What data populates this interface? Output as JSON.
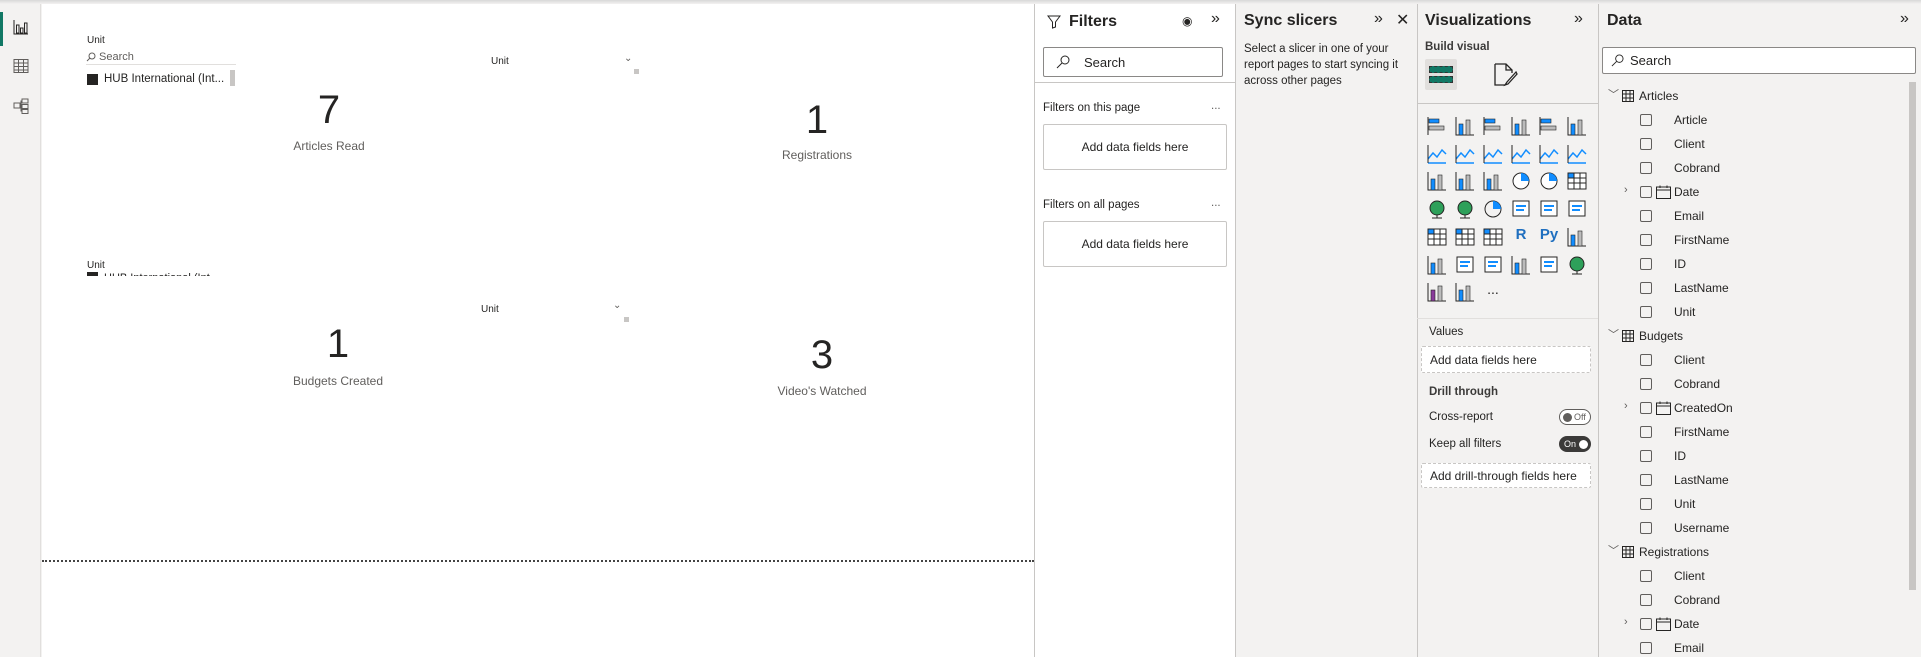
{
  "nav": {
    "items": [
      {
        "name": "report-view",
        "icon": "bar-chart-icon",
        "selected": true
      },
      {
        "name": "table-view",
        "icon": "table-icon"
      },
      {
        "name": "model-view",
        "icon": "model-icon"
      }
    ]
  },
  "canvas": {
    "slicer_list": {
      "title": "Unit",
      "search_placeholder": "Search",
      "item": "HUB International (Int..."
    },
    "slicer_list_2": {
      "title": "Unit",
      "item": "HUB International (Int..."
    },
    "dropdown_1": {
      "title": "Unit"
    },
    "dropdown_2": {
      "title": "Unit"
    },
    "cards": [
      {
        "value": "7",
        "label": "Articles Read"
      },
      {
        "value": "1",
        "label": "Registrations"
      },
      {
        "value": "1",
        "label": "Budgets Created"
      },
      {
        "value": "3",
        "label": "Video's Watched"
      }
    ]
  },
  "filters": {
    "title": "Filters",
    "search_placeholder": "Search",
    "this_page": {
      "label": "Filters on this page",
      "more": "...",
      "drop": "Add data fields here"
    },
    "all_pages": {
      "label": "Filters on all pages",
      "more": "...",
      "drop": "Add data fields here"
    }
  },
  "sync": {
    "title": "Sync slicers",
    "message_lines": [
      "Select a slicer in one of your",
      "report pages to start syncing it",
      "across other pages"
    ]
  },
  "viz": {
    "title": "Visualizations",
    "build_visual": "Build visual",
    "accent": "#117865",
    "icons": [
      "stacked-bar-icon",
      "stacked-column-icon",
      "clustered-bar-icon",
      "clustered-column-icon",
      "100-stacked-bar-icon",
      "100-stacked-column-icon",
      "line-chart-icon",
      "area-chart-icon",
      "stacked-area-icon",
      "line-clustered-column-icon",
      "line-stacked-column-icon",
      "ribbon-chart-icon",
      "waterfall-icon",
      "funnel-icon",
      "scatter-icon",
      "pie-icon",
      "donut-icon",
      "treemap-icon",
      "map-icon",
      "filled-map-icon",
      "gauge-icon",
      "card-icon",
      "multi-row-card-icon",
      "kpi-icon",
      "slicer-icon",
      "table-icon",
      "matrix-icon",
      "r-visual-icon",
      "python-visual-icon",
      "key-influencers-icon",
      "decomposition-tree-icon",
      "qa-icon",
      "smart-narrative-icon",
      "trophy-icon",
      "paginated-report-icon",
      "azure-map-icon",
      "power-apps-icon",
      "power-automate-icon",
      "more-icon"
    ],
    "r_label": "R",
    "py_label": "Py",
    "more_label": "...",
    "values_label": "Values",
    "values_drop": "Add data fields here",
    "drill_through": "Drill through",
    "cross_report": {
      "label": "Cross-report",
      "state": "Off"
    },
    "keep_all_filters": {
      "label": "Keep all filters",
      "state": "On"
    },
    "drill_drop": "Add drill-through fields here"
  },
  "data": {
    "title": "Data",
    "search_placeholder": "Search",
    "tables": [
      {
        "name": "Articles",
        "fields": [
          {
            "name": "Article"
          },
          {
            "name": "Client"
          },
          {
            "name": "Cobrand"
          },
          {
            "name": "Date",
            "date": true
          },
          {
            "name": "Email"
          },
          {
            "name": "FirstName"
          },
          {
            "name": "ID"
          },
          {
            "name": "LastName"
          },
          {
            "name": "Unit"
          }
        ]
      },
      {
        "name": "Budgets",
        "fields": [
          {
            "name": "Client"
          },
          {
            "name": "Cobrand"
          },
          {
            "name": "CreatedOn",
            "date": true
          },
          {
            "name": "FirstName"
          },
          {
            "name": "ID"
          },
          {
            "name": "LastName"
          },
          {
            "name": "Unit"
          },
          {
            "name": "Username"
          }
        ]
      },
      {
        "name": "Registrations",
        "fields": [
          {
            "name": "Client"
          },
          {
            "name": "Cobrand"
          },
          {
            "name": "Date",
            "date": true
          },
          {
            "name": "Email"
          }
        ]
      }
    ]
  }
}
